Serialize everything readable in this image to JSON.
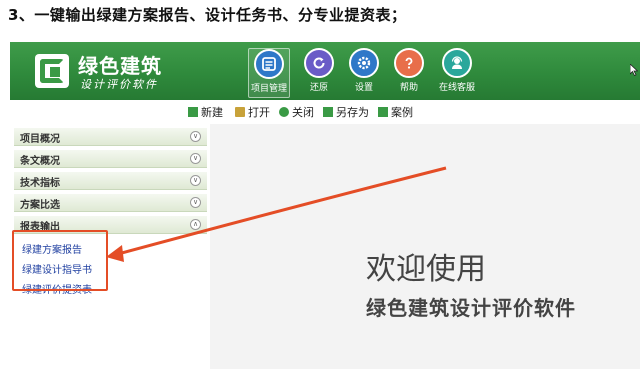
{
  "caption": "3、一键输出绿建方案报告、设计任务书、分专业提资表；",
  "app": {
    "brand_title": "绿色建筑",
    "brand_subtitle": "设计评价软件"
  },
  "toolbar_big": [
    {
      "label": "项目管理",
      "icon": "project-manage-icon",
      "color": "#2f78c8"
    },
    {
      "label": "还原",
      "icon": "restore-icon",
      "color": "#6a5cc7"
    },
    {
      "label": "设置",
      "icon": "settings-icon",
      "color": "#2f78c8"
    },
    {
      "label": "帮助",
      "icon": "help-icon",
      "color": "#e86e4a"
    },
    {
      "label": "在线客服",
      "icon": "online-service-icon",
      "color": "#2aa79b"
    }
  ],
  "toolbar_small": [
    {
      "label": "新建",
      "icon": "new-file-icon",
      "color": "#3a9a45"
    },
    {
      "label": "打开",
      "icon": "open-folder-icon",
      "color": "#3a9a45"
    },
    {
      "label": "关闭",
      "icon": "close-icon",
      "color": "#3a9a45"
    },
    {
      "label": "另存为",
      "icon": "save-as-icon",
      "color": "#3a9a45"
    },
    {
      "label": "案例",
      "icon": "case-icon",
      "color": "#3a9a45"
    }
  ],
  "sidebar": {
    "menu": [
      "项目概况",
      "条文概况",
      "技术指标",
      "方案比选",
      "报表输出"
    ],
    "submenu": [
      "绿建方案报告",
      "绿建设计指导书",
      "绿建评价提资表"
    ]
  },
  "welcome": {
    "title": "欢迎使用",
    "subtitle": "绿色建筑设计评价软件"
  },
  "colors": {
    "header": "#2f8a3c",
    "highlight": "#e44d26"
  }
}
